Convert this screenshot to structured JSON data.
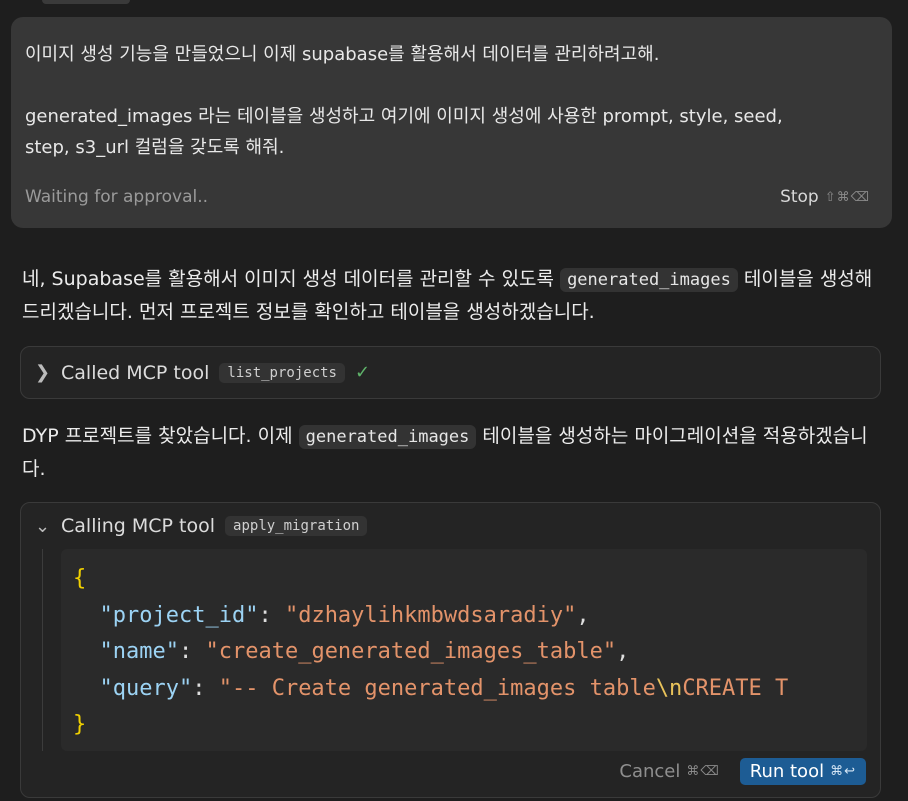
{
  "user_message": {
    "line1": "이미지 생성 기능을 만들었으니 이제 supabase를 활용해서 데이터를 관리하려고해.",
    "line2": "generated_images 라는 테이블을 생성하고 여기에 이미지 생성에 사용한 prompt, style, seed,",
    "line3": "step, s3_url 컬럼을 갖도록 해줘.",
    "status": "Waiting for approval..",
    "stop_label": "Stop",
    "stop_shortcut": "⇧⌘⌫"
  },
  "assistant1": {
    "pre": "네, Supabase를 활용해서 이미지 생성 데이터를 관리할 수 있도록 ",
    "code": "generated_images",
    "post": " 테이블을 생성해드리겠습니다. 먼저 프로젝트 정보를 확인하고 테이블을 생성하겠습니다."
  },
  "tool_call_1": {
    "title": "Called MCP tool",
    "tool_name": "list_projects",
    "chevron_icon": "chevron-right-icon",
    "check_icon": "check-icon"
  },
  "assistant2": {
    "pre": "DYP 프로젝트를 찾았습니다. 이제 ",
    "code": "generated_images",
    "post": " 테이블을 생성하는 마이그레이션을 적용하겠습니다."
  },
  "tool_call_2": {
    "title": "Calling MCP tool",
    "tool_name": "apply_migration",
    "chevron_icon": "chevron-down-icon",
    "args": {
      "open_brace": "{",
      "close_brace": "}",
      "k1": "\"project_id\"",
      "v1": "\"dzhaylihkmbwdsaradiy\"",
      "k2": "\"name\"",
      "v2": "\"create_generated_images_table\"",
      "k3": "\"query\"",
      "v3a": "\"-- Create generated_images table",
      "v3esc": "\\n",
      "v3b": "CREATE T"
    },
    "cancel_label": "Cancel",
    "cancel_shortcut": "⌘⌫",
    "run_label": "Run tool",
    "run_shortcut": "⌘↩"
  },
  "colors": {
    "background": "#1e1e1e",
    "run_button": "#1d5c94",
    "json_key": "#9cd3f4",
    "json_string": "#e3936a",
    "brace": "#f0d000"
  }
}
